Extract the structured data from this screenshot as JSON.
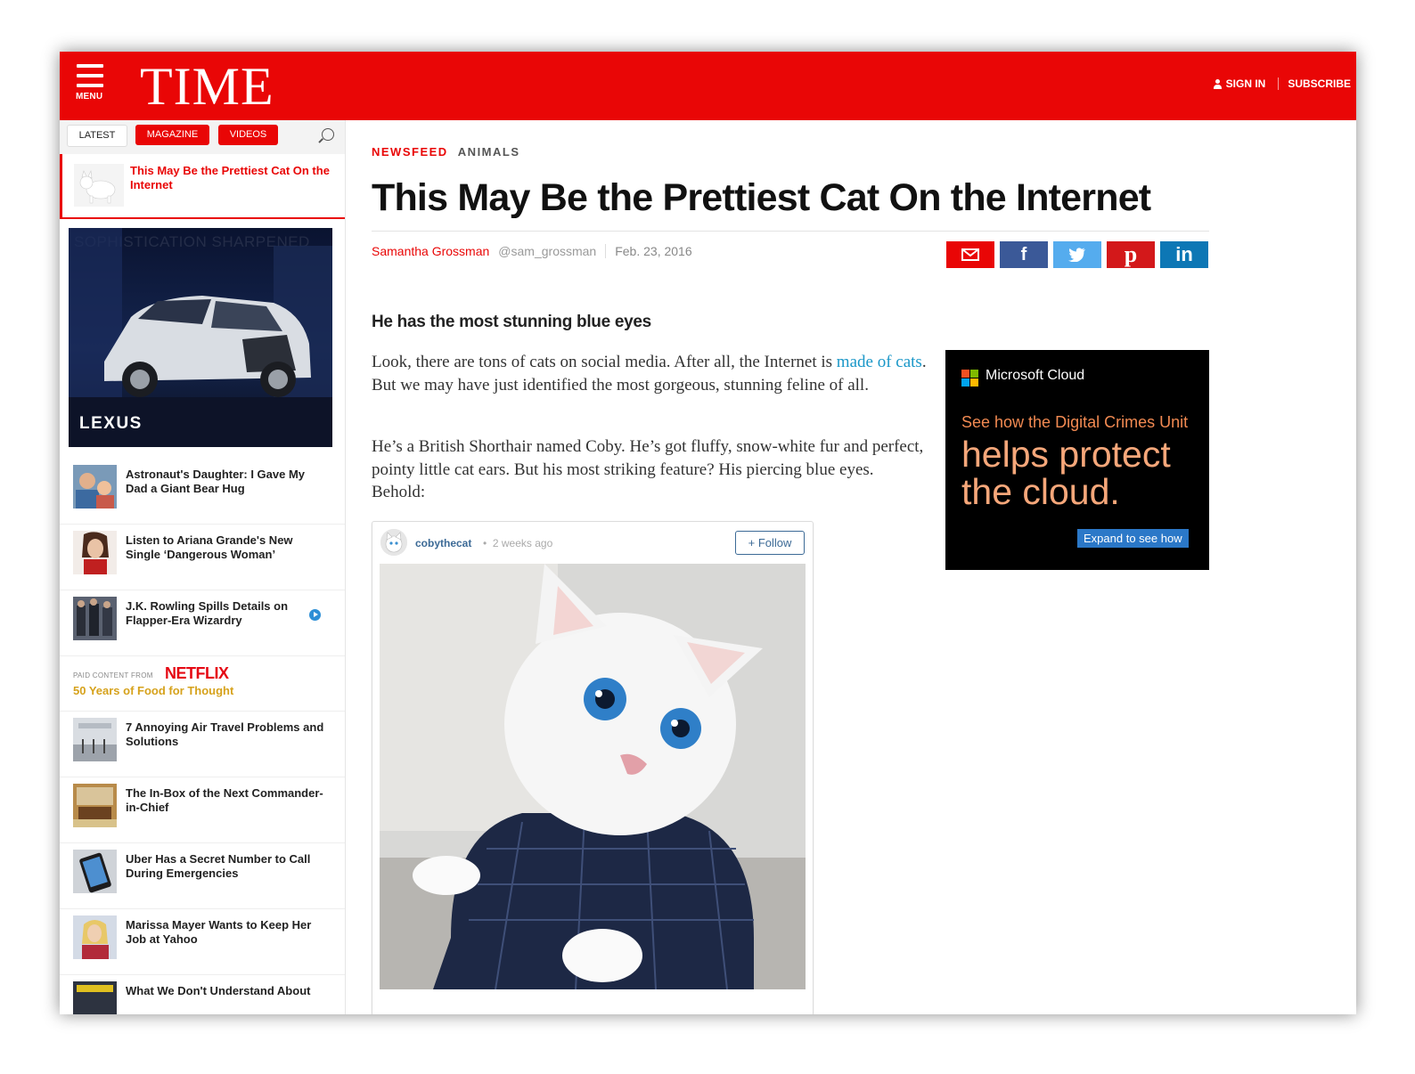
{
  "header": {
    "menu_label": "MENU",
    "logo": "TIME",
    "sign_in": "SIGN IN",
    "subscribe": "SUBSCRIBE",
    "brand_color": "#e90606"
  },
  "sidebar": {
    "tabs": [
      "LATEST",
      "MAGAZINE",
      "VIDEOS"
    ],
    "active_item": "This May Be the Prettiest Cat On the Internet",
    "ad": {
      "ghost_text": "SOPHISTICATION SHARPENED",
      "brand": "LEXUS"
    },
    "items": [
      {
        "title": "Astronaut's Daughter: I Gave My Dad a Giant Bear Hug"
      },
      {
        "title": "Listen to Ariana Grande's New Single ‘Dangerous Woman’"
      },
      {
        "title": "J.K. Rowling Spills Details on Flapper-Era Wizardry",
        "icon": "play-icon"
      },
      {
        "title": "7 Annoying Air Travel Problems and Solutions"
      },
      {
        "title": "The In-Box of the Next Commander-in-Chief"
      },
      {
        "title": "Uber Has a Secret Number to Call During Emergencies"
      },
      {
        "title": "Marissa Mayer Wants to Keep Her Job at Yahoo"
      },
      {
        "title": "What We Don't Understand About"
      }
    ],
    "sponsored": {
      "label": "PAID CONTENT FROM",
      "sponsor": "NETFLIX",
      "title": "50 Years of Food for Thought"
    }
  },
  "article": {
    "section": "NEWSFEED",
    "subsection": "ANIMALS",
    "headline": "This May Be the Prettiest Cat On the Internet",
    "author": "Samantha Grossman",
    "handle": "@sam_grossman",
    "date": "Feb. 23, 2016",
    "share_icons": [
      "mail-icon",
      "facebook-icon",
      "twitter-icon",
      "pinterest-icon",
      "linkedin-icon"
    ],
    "dek": "He has the most stunning blue eyes",
    "p1_before": "Look, there are tons of cats on social media. After all, the Internet is ",
    "p1_link": "made of cats",
    "p1_after": ". But we may have just identified the most gorgeous, stunning feline of all.",
    "p2": "He’s a British Shorthair named Coby. He’s got fluffy, snow-white fur and perfect, pointy little cat ears. But his most striking feature? His piercing blue eyes. Behold:",
    "link_color": "#1a97c8"
  },
  "instagram": {
    "username": "cobythecat",
    "separator": "•",
    "time_ago": "2 weeks ago",
    "follow": "+ Follow"
  },
  "ms_ad": {
    "brand": "Microsoft Cloud",
    "line1": "See how the Digital Crimes Unit",
    "big": "helps protect the cloud.",
    "cta": "Expand to see how"
  }
}
